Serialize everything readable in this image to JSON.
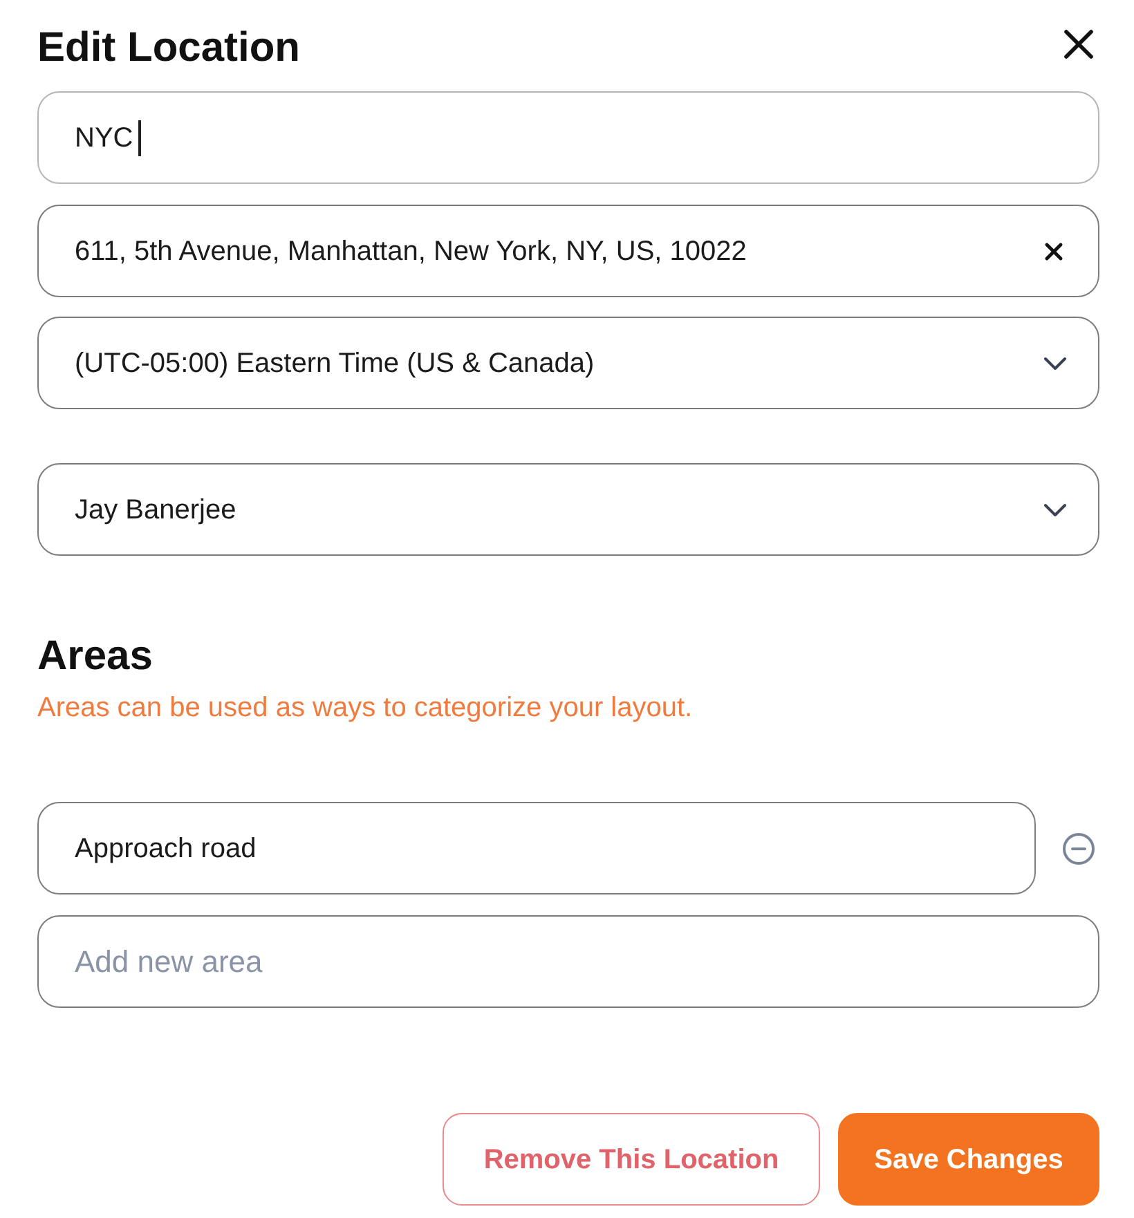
{
  "dialog": {
    "title": "Edit Location"
  },
  "fields": [
    {
      "kind": "text",
      "value": "NYC",
      "focused": true
    },
    {
      "kind": "clearable",
      "value": "611, 5th Avenue, Manhattan, New York, NY, US, 10022",
      "focused": false
    },
    {
      "kind": "select",
      "value": "(UTC-05:00) Eastern Time (US & Canada)",
      "focused": false
    },
    {
      "kind": "select",
      "value": "Jay Banerjee",
      "focused": false
    }
  ],
  "areas": {
    "title": "Areas",
    "description": "Areas can be used as ways to categorize your layout.",
    "items": [
      {
        "value": "Approach road"
      }
    ],
    "new_area": {
      "placeholder": "Add new area"
    }
  },
  "buttons": [
    {
      "kind": "outline-danger",
      "label": "Remove This Location"
    },
    {
      "kind": "primary",
      "label": "Save Changes"
    }
  ]
}
